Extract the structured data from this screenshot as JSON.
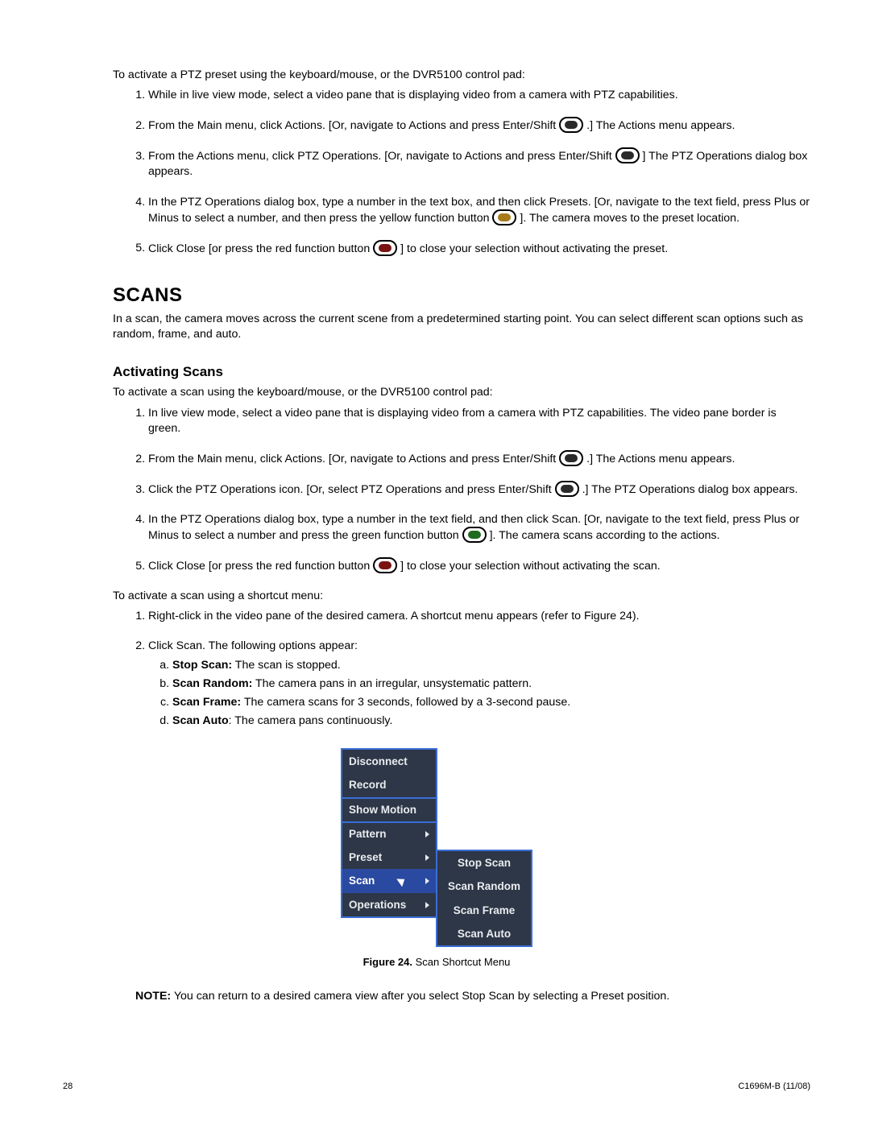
{
  "preset": {
    "intro": "To activate a PTZ preset using the keyboard/mouse, or the DVR5100 control pad:",
    "step1": "While in live view mode, select a video pane that is displaying video from a camera with PTZ capabilities.",
    "step2_a": "From the Main menu, click Actions. [Or, navigate to Actions and press Enter/Shift ",
    "step2_b": " .] The Actions menu appears.",
    "step3_a": "From the Actions menu, click PTZ Operations. [Or, navigate to Actions and press Enter/Shift ",
    "step3_b": " ] The PTZ Operations dialog box appears.",
    "step4_a": "In the PTZ Operations dialog box, type a number in the text box, and then click Presets. [Or, navigate to the text field, press Plus or Minus to select a number, and then press the yellow function button ",
    "step4_b": " ]. The camera moves to the preset location.",
    "step5_a": "Click Close [or press the red function button ",
    "step5_b": " ] to close your selection without activating the preset."
  },
  "scans": {
    "heading": "SCANS",
    "intro": "In a scan, the camera moves across the current scene from a predetermined starting point. You can select different scan options such as random, frame, and auto.",
    "subheading": "Activating Scans",
    "activate_intro": "To activate a scan using the keyboard/mouse, or the DVR5100 control pad:",
    "step1": "In live view mode, select a video pane that is displaying video from a camera with PTZ capabilities. The video pane border is green.",
    "step2_a": "From the Main menu, click Actions. [Or, navigate to Actions and press Enter/Shift ",
    "step2_b": " .] The Actions menu appears.",
    "step3_a": "Click the PTZ Operations icon. [Or, select PTZ Operations and press Enter/Shift ",
    "step3_b": " .] The PTZ Operations dialog box appears.",
    "step4_a": "In the PTZ Operations dialog box, type a number in the text field, and then click Scan. [Or, navigate to the text field, press Plus or Minus to select a number and press the green function button ",
    "step4_b": " ]. The camera scans according to the actions.",
    "step5_a": "Click Close [or press the red function button ",
    "step5_b": " ] to close your selection without activating the scan.",
    "shortcut_intro": "To activate a scan using a shortcut menu:",
    "sc_step1": "Right-click in the video pane of the desired camera. A shortcut menu appears (refer to Figure 24).",
    "sc_step2": "Click Scan. The following options appear:",
    "opt_a_b": "Stop Scan:",
    "opt_a_t": " The scan is stopped.",
    "opt_b_b": "Scan Random:",
    "opt_b_t": " The camera pans in an irregular, unsystematic pattern.",
    "opt_c_b": "Scan Frame:",
    "opt_c_t": " The camera scans for 3 seconds, followed by a 3-second pause.",
    "opt_d_b": "Scan Auto",
    "opt_d_t": ": The camera pans continuously."
  },
  "menu": {
    "items": [
      "Disconnect",
      "Record",
      "Show Motion",
      "Pattern",
      "Preset",
      "Scan",
      "Operations"
    ],
    "sub": [
      "Stop Scan",
      "Scan Random",
      "Scan Frame",
      "Scan Auto"
    ]
  },
  "figure": {
    "label": "Figure 24.",
    "caption": "  Scan Shortcut Menu"
  },
  "note": {
    "label": "NOTE:",
    "text": "  You can return to a desired camera view after you select Stop Scan by selecting a Preset position."
  },
  "footer": {
    "page": "28",
    "doc": "C1696M-B  (11/08)"
  }
}
